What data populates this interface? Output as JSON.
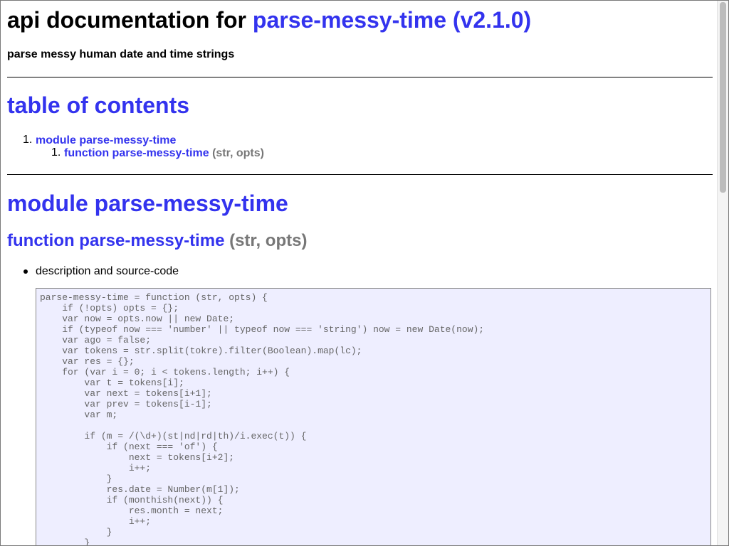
{
  "header": {
    "title_prefix": "api documentation for",
    "title_link": "parse-messy-time (v2.1.0)",
    "subtitle": "parse messy human date and time strings"
  },
  "toc": {
    "heading": "table of contents",
    "items": [
      {
        "number": "1.",
        "label": "module parse-messy-time"
      },
      {
        "number": "1.",
        "label": "function parse-messy-time",
        "args": "(str, opts)"
      }
    ]
  },
  "module": {
    "heading": "module parse-messy-time",
    "function_label": "function parse-messy-time",
    "function_args": "(str, opts)",
    "bullet": "description and source-code",
    "code_lines": [
      "parse-messy-time = function (str, opts) {",
      "    if (!opts) opts = {};",
      "    var now = opts.now || new Date;",
      "    if (typeof now === 'number' || typeof now === 'string') now = new Date(now);",
      "    var ago = false;",
      "    var tokens = str.split(tokre).filter(Boolean).map(lc);",
      "    var res = {};",
      "    for (var i = 0; i < tokens.length; i++) {",
      "        var t = tokens[i];",
      "        var next = tokens[i+1];",
      "        var prev = tokens[i-1];",
      "        var m;",
      "",
      "        if (m = /(\\d+)(st|nd|rd|th)/i.exec(t)) {",
      "            if (next === 'of') {",
      "                next = tokens[i+2];",
      "                i++;",
      "            }",
      "            res.date = Number(m[1]);",
      "            if (monthish(next)) {",
      "                res.month = next;",
      "                i++;",
      "            }",
      "        }"
    ]
  }
}
